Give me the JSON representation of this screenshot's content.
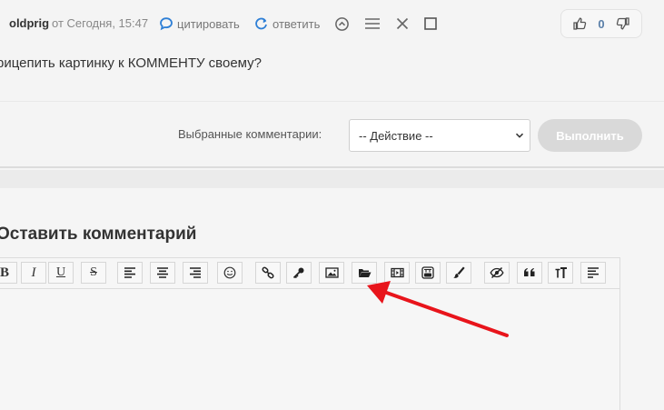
{
  "comment": {
    "author": "oldprig",
    "date": "от Сегодня, 15:47",
    "quote_label": "цитировать",
    "reply_label": "ответить",
    "rating_count": "0",
    "text": "рицепить картинку к КОММЕНТУ своему?"
  },
  "selected": {
    "label": "Выбранные комментарии:",
    "action_value": "-- Действие --",
    "run_label": "Выполнить"
  },
  "leave": {
    "title": "Оставить комментарий",
    "toolbar": {
      "bold": "B",
      "italic": "I",
      "underline": "U",
      "strike": "S"
    }
  },
  "colors": {
    "accent": "#2e7fd6",
    "arrow": "#e8141b"
  }
}
